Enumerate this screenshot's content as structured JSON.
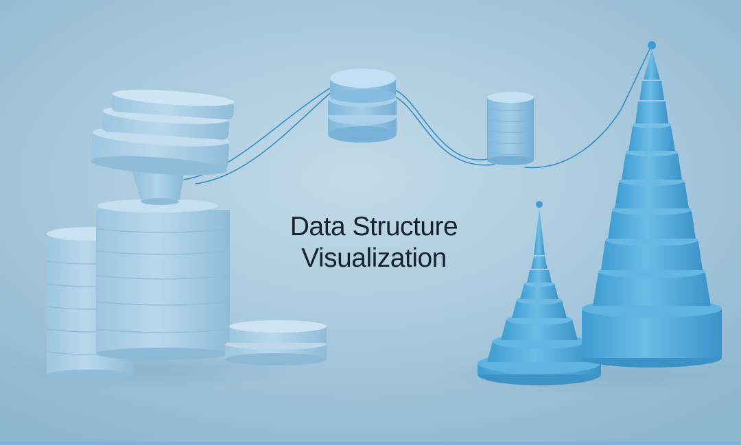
{
  "title": {
    "line1": "Data Structure",
    "line2": "Visualization"
  },
  "colors": {
    "background": "#b3d0e1",
    "disk_pale": "#b6d4e8",
    "disk_mid": "#8ec0e0",
    "cone_blue": "#4da7d9",
    "wire": "#2f8fc6",
    "text": "#17232c"
  }
}
